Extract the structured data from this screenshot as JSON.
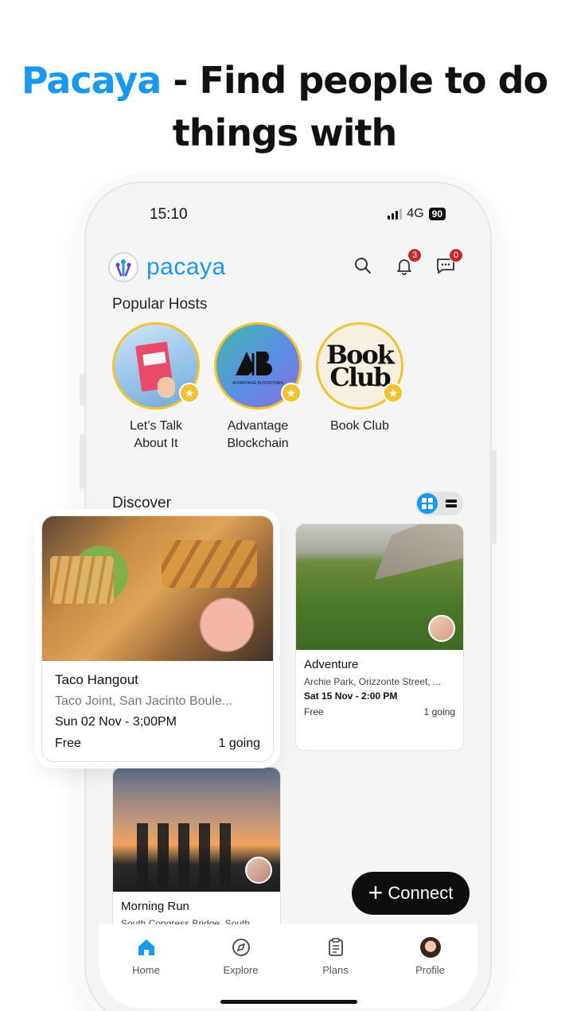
{
  "headline": {
    "brand": "Pacaya",
    "rest": " - Find people to do things with"
  },
  "status": {
    "time": "15:10",
    "network": "4G",
    "battery": "90"
  },
  "appbar": {
    "name": "pacaya",
    "notifications_count": "3",
    "messages_count": "0"
  },
  "popular_hosts": {
    "title": "Popular Hosts",
    "items": [
      {
        "label": "Let’s Talk About It"
      },
      {
        "label": "Advantage Blockchain",
        "logo_text": "AB",
        "logo_sub": "ADVANTAGE BLOCKCHAIN"
      },
      {
        "label": "Book Club",
        "logo_line1": "Book",
        "logo_line2": "Club"
      }
    ]
  },
  "discover": {
    "title": "Discover",
    "cards": [
      {
        "title": "Adventure",
        "location": "Archie Park, Orizzonte Street, ...",
        "date": "Sat 15 Nov - 2:00 PM",
        "price": "Free",
        "going": "1 going"
      },
      {
        "title": "Morning Run",
        "location": "South Congress Bridge, South..."
      }
    ],
    "featured": {
      "title": "Taco Hangout",
      "location": "Taco Joint, San Jacinto Boule...",
      "date": "Sun 02 Nov - 3;00PM",
      "price": "Free",
      "going": "1 going"
    }
  },
  "fab": {
    "label": "Connect"
  },
  "tabs": [
    {
      "label": "Home",
      "icon": "home-icon"
    },
    {
      "label": "Explore",
      "icon": "compass-icon"
    },
    {
      "label": "Plans",
      "icon": "clipboard-icon"
    },
    {
      "label": "Profile",
      "icon": "avatar"
    }
  ],
  "colors": {
    "brand": "#1a98ee",
    "star": "#f2c230",
    "badge": "#c62828"
  }
}
